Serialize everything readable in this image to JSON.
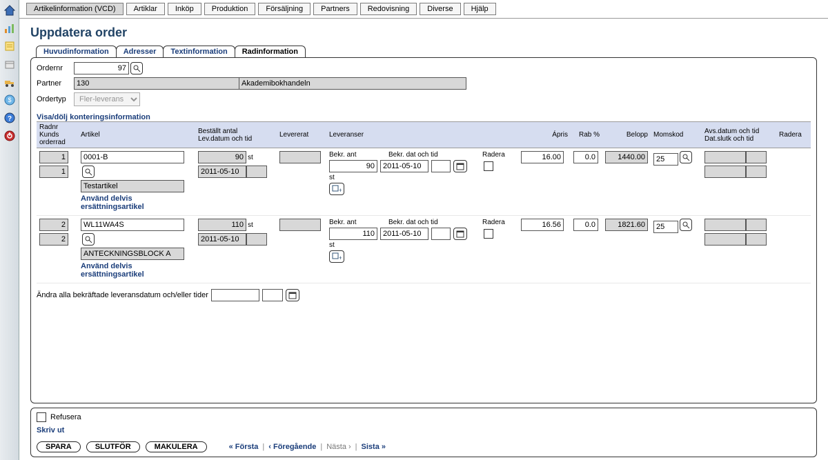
{
  "sidebar": {
    "icons": [
      "home",
      "chart",
      "note",
      "box",
      "truck",
      "coin",
      "help",
      "power"
    ]
  },
  "menu": {
    "items": [
      "Artikelinformation (VCD)",
      "Artiklar",
      "Inköp",
      "Produktion",
      "Försäljning",
      "Partners",
      "Redovisning",
      "Diverse",
      "Hjälp"
    ],
    "active_index": 0
  },
  "page": {
    "title": "Uppdatera order"
  },
  "tabs": {
    "items": [
      "Huvudinformation",
      "Adresser",
      "Textinformation",
      "Radinformation"
    ],
    "active_index": 3
  },
  "header": {
    "ordernr_label": "Ordernr",
    "ordernr_value": "97",
    "partner_label": "Partner",
    "partner_id": "130",
    "partner_name": "Akademibokhandeln",
    "ordertyp_label": "Ordertyp",
    "ordertyp_value": "Fler-leverans"
  },
  "section": {
    "toggle_label": "Visa/dölj konteringsinformation"
  },
  "columns": {
    "radnr": "Radnr\nKunds orderrad",
    "artikel": "Artikel",
    "bestallt": "Beställt antal\nLev.datum och tid",
    "levererat": "Levererat",
    "leveranser": "Leveranser",
    "apris": "Ápris",
    "rab": "Rab %",
    "belopp": "Belopp",
    "momskod": "Momskod",
    "avs": "Avs.datum och tid\nDat.slutk och tid",
    "radera": "Radera"
  },
  "leveranser_labels": {
    "bekr_ant": "Bekr. ant",
    "bekr_dat": "Bekr. dat och tid",
    "radera": "Radera",
    "unit": "st"
  },
  "rows": [
    {
      "radnr": "1",
      "kundrad": "1",
      "artikel_code": "0001-B",
      "artikel_name": "Testartikel",
      "replace_link": "Använd delvis ersättningsartikel",
      "best_antal": "90",
      "unit": "st",
      "lev_datum": "2011-05-10",
      "lev_tid": "",
      "bekr_ant": "90",
      "bekr_dat": "2011-05-10",
      "bekr_tid": "",
      "apris": "16.00",
      "rab": "0.0",
      "belopp": "1440.00",
      "momskod": "25"
    },
    {
      "radnr": "2",
      "kundrad": "2",
      "artikel_code": "WL11WA4S",
      "artikel_name": "ANTECKNINGSBLOCK A",
      "replace_link": "Använd delvis ersättningsartikel",
      "best_antal": "110",
      "unit": "st",
      "lev_datum": "2011-05-10",
      "lev_tid": "",
      "bekr_ant": "110",
      "bekr_dat": "2011-05-10",
      "bekr_tid": "",
      "apris": "16.56",
      "rab": "0.0",
      "belopp": "1821.60",
      "momskod": "25"
    }
  ],
  "bulk": {
    "label": "Ändra alla bekräftade leveransdatum och/eller tider"
  },
  "footer": {
    "refusera": "Refusera",
    "skriv_ut": "Skriv ut",
    "spara": "SPARA",
    "slutfor": "SLUTFÖR",
    "makulera": "MAKULERA",
    "nav_first": "« Första",
    "nav_prev": "‹ Föregående",
    "nav_next": "Nästa ›",
    "nav_last": "Sista »"
  }
}
